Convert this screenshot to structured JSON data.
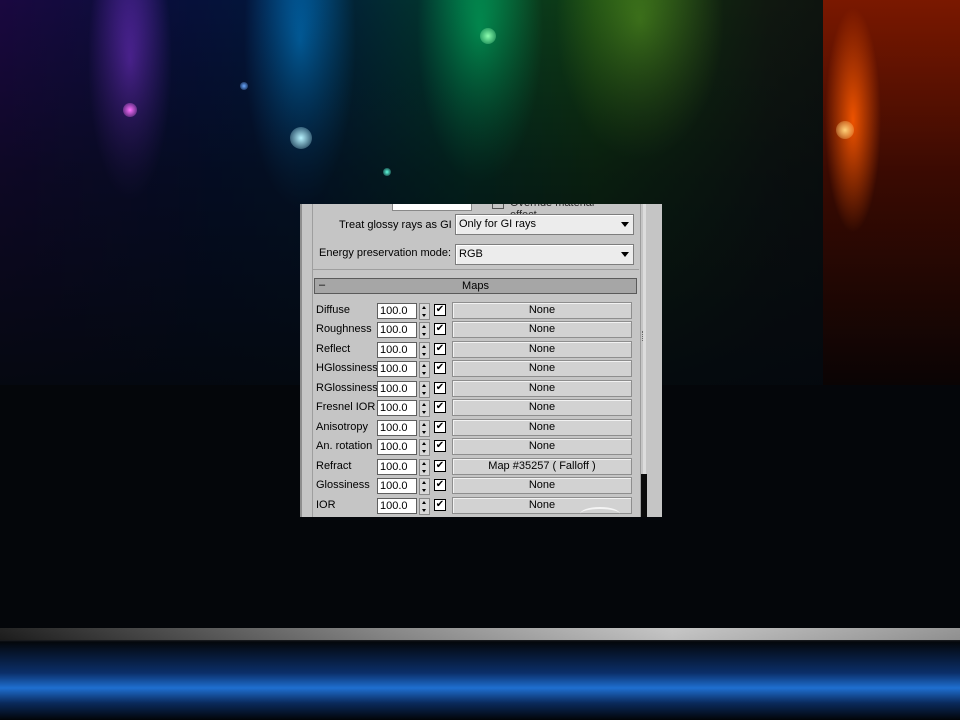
{
  "panel": {
    "glossy_label": "Treat glossy rays as GI",
    "glossy_value": "Only for GI rays",
    "energy_label": "Energy preservation mode:",
    "energy_value": "RGB",
    "cut_label": "Override material effect",
    "rollout_toggle": "–",
    "rollout_title": "Maps",
    "maps": [
      {
        "name": "Diffuse",
        "amount": "100.0",
        "checked": "✔",
        "map": "None"
      },
      {
        "name": "Roughness",
        "amount": "100.0",
        "checked": "✔",
        "map": "None"
      },
      {
        "name": "Reflect",
        "amount": "100.0",
        "checked": "✔",
        "map": "None"
      },
      {
        "name": "HGlossiness",
        "amount": "100.0",
        "checked": "✔",
        "map": "None"
      },
      {
        "name": "RGlossiness",
        "amount": "100.0",
        "checked": "✔",
        "map": "None"
      },
      {
        "name": "Fresnel IOR",
        "amount": "100.0",
        "checked": "✔",
        "map": "None"
      },
      {
        "name": "Anisotropy",
        "amount": "100.0",
        "checked": "✔",
        "map": "None"
      },
      {
        "name": "An. rotation",
        "amount": "100.0",
        "checked": "✔",
        "map": "None"
      },
      {
        "name": "Refract",
        "amount": "100.0",
        "checked": "✔",
        "map": "Map #35257  ( Falloff )"
      },
      {
        "name": "Glossiness",
        "amount": "100.0",
        "checked": "✔",
        "map": "None"
      },
      {
        "name": "IOR",
        "amount": "100.0",
        "checked": "✔",
        "map": "None"
      }
    ]
  },
  "colors": {
    "panel_bg": "#c5c5c5",
    "rollout_bg": "#a6a6a6",
    "button_bg": "#d2d2d2"
  }
}
